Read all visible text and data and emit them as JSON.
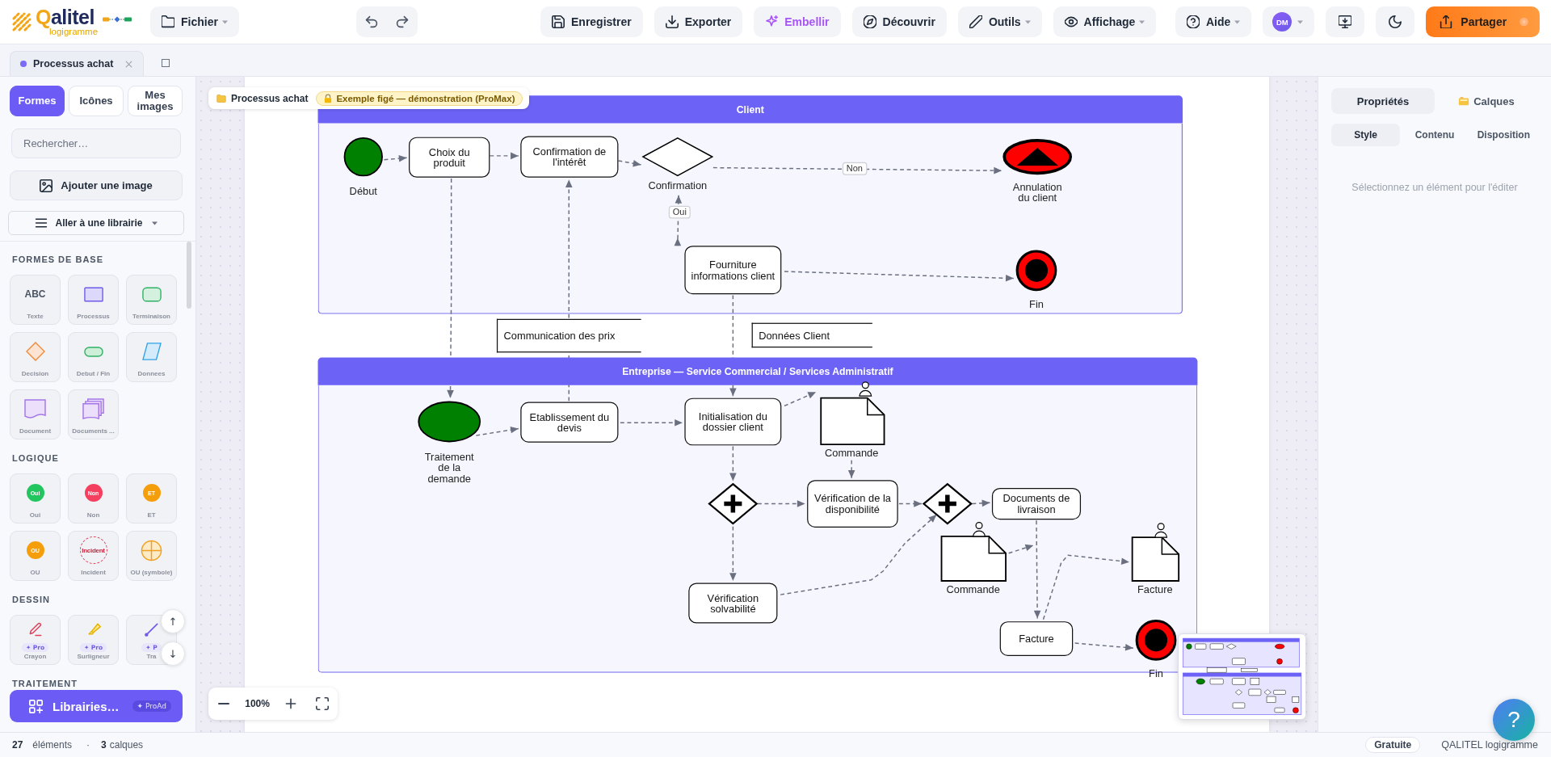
{
  "toolbar": {
    "logo": {
      "name": "Qalitel",
      "tagline": "logigramme"
    },
    "file_menu": {
      "label": "Fichier",
      "dropdown": true
    },
    "history": [
      {
        "kind": "undo"
      },
      {
        "kind": "redo"
      }
    ],
    "actions": [
      {
        "kind": "save",
        "label": "Enregistrer",
        "dropdown": false
      },
      {
        "kind": "export",
        "label": "Exporter",
        "dropdown": false
      },
      {
        "kind": "beautify",
        "label": "Embellir",
        "dropdown": false
      },
      {
        "kind": "discover",
        "label": "Découvrir",
        "dropdown": false
      },
      {
        "kind": "tools",
        "label": "Outils",
        "dropdown": true
      },
      {
        "kind": "view",
        "label": "Affichage",
        "dropdown": true
      }
    ],
    "help": {
      "label": "Aide",
      "dropdown": true
    },
    "account": {
      "initials": "DM",
      "dropdown": true
    },
    "utilities": [
      {
        "kind": "present"
      },
      {
        "kind": "theme"
      }
    ],
    "share": {
      "label": "Partager"
    }
  },
  "document_tabs": [
    {
      "label": "Processus achat",
      "selected": true
    }
  ],
  "sidebar": {
    "tabs": [
      {
        "label": "Formes",
        "selected": true
      },
      {
        "label": "Icônes",
        "selected": false
      },
      {
        "label": "Mes images",
        "selected": false
      }
    ],
    "search": {
      "placeholder": "Rechercher…"
    },
    "add_image": "Ajouter une image",
    "library_menu": {
      "label": "Aller à une librairie",
      "dropdown": true
    },
    "sections": [
      {
        "title": "FORMES DE BASE",
        "items": [
          {
            "kind": "text",
            "label": "Texte",
            "glyph": "ABC"
          },
          {
            "kind": "process",
            "label": "Processus"
          },
          {
            "kind": "terminal",
            "label": "Terminaison"
          },
          {
            "kind": "decision",
            "label": "Decision"
          },
          {
            "kind": "start_end",
            "label": "Debut / Fin"
          },
          {
            "kind": "data",
            "label": "Donnees"
          },
          {
            "kind": "document",
            "label": "Document"
          },
          {
            "kind": "documents",
            "label": "Documents ..."
          }
        ]
      },
      {
        "title": "LOGIQUE",
        "items": [
          {
            "kind": "yes",
            "label": "Oui",
            "glyph": "Oui"
          },
          {
            "kind": "no",
            "label": "Non",
            "glyph": "Non"
          },
          {
            "kind": "and",
            "label": "ET",
            "glyph": "ET"
          },
          {
            "kind": "or",
            "label": "OU",
            "glyph": "OU"
          },
          {
            "kind": "incident",
            "label": "Incident",
            "glyph": "Incident"
          },
          {
            "kind": "or_symbol",
            "label": "OU (symbole)"
          }
        ]
      },
      {
        "title": "DESSIN",
        "items": [
          {
            "kind": "pencil",
            "label": "Crayon",
            "badge": "✦ Pro"
          },
          {
            "kind": "highlighter",
            "label": "Surligneur",
            "badge": "✦ Pro"
          },
          {
            "kind": "line",
            "label": "Tra",
            "badge": "✦ P"
          }
        ]
      },
      {
        "title": "TRAITEMENT"
      }
    ],
    "scroll_buttons": [
      "↑",
      "↓"
    ],
    "libraries_button": {
      "label": "Librairies…",
      "tag": "✦ ProAd"
    }
  },
  "canvas": {
    "breadcrumb": {
      "title": "Processus achat",
      "badge": "Exemple figé — démonstration (ProMax)"
    },
    "lanes": [
      {
        "title": "Client"
      },
      {
        "title": "Entreprise — Service Commercial / Services Administratif"
      }
    ],
    "nodes": [
      {
        "kind": "start",
        "label": "Début"
      },
      {
        "kind": "task",
        "label": "Choix du produit"
      },
      {
        "kind": "task",
        "label": "Confirmation de l'intérêt"
      },
      {
        "kind": "decision",
        "label": "Confirmation"
      },
      {
        "kind": "cancel_end",
        "label": "Annulation du client"
      },
      {
        "kind": "task",
        "label": "Fourniture informations client"
      },
      {
        "kind": "end",
        "label": "Fin"
      },
      {
        "kind": "annotation",
        "label": "Communication des prix"
      },
      {
        "kind": "annotation",
        "label": "Données Client"
      },
      {
        "kind": "start",
        "label": "Traitement de la demande"
      },
      {
        "kind": "task",
        "label": "Etablissement du devis"
      },
      {
        "kind": "task",
        "label": "Initialisation du dossier client"
      },
      {
        "kind": "document",
        "label": "Commande"
      },
      {
        "kind": "parallel"
      },
      {
        "kind": "task",
        "label": "Vérification de la disponibilité"
      },
      {
        "kind": "parallel"
      },
      {
        "kind": "task",
        "label": "Documents de livraison"
      },
      {
        "kind": "task",
        "label": "Vérification solvabilité"
      },
      {
        "kind": "document",
        "label": "Commande"
      },
      {
        "kind": "document",
        "label": "Facture"
      },
      {
        "kind": "task",
        "label": "Facture"
      },
      {
        "kind": "end",
        "label": "Fin"
      }
    ],
    "connector_labels": [
      "Non",
      "Oui"
    ],
    "zoom_reading": "100%"
  },
  "properties_panel": {
    "tabs": [
      {
        "kind": "properties",
        "label": "Propriétés",
        "selected": true
      },
      {
        "kind": "layers",
        "label": "Calques",
        "selected": false
      }
    ],
    "subtabs": [
      {
        "label": "Style",
        "selected": true
      },
      {
        "label": "Contenu",
        "selected": false
      },
      {
        "label": "Disposition",
        "selected": false
      }
    ],
    "empty_message": "Sélectionnez un élément pour l'éditer"
  },
  "status_bar": {
    "element_count": "27",
    "elements_label": "éléments",
    "separator": "·",
    "layer_count": "3",
    "layers_label": "calques",
    "plan": "Gratuite",
    "app_name": "QALITEL logigramme"
  },
  "help_button": "?"
}
